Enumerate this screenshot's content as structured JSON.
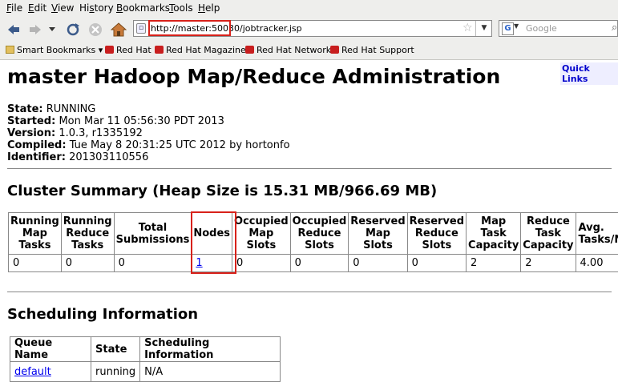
{
  "menubar": {
    "items": [
      {
        "pre": "",
        "u": "F",
        "post": "ile"
      },
      {
        "pre": "",
        "u": "E",
        "post": "dit"
      },
      {
        "pre": "",
        "u": "V",
        "post": "iew"
      },
      {
        "pre": "Hi",
        "u": "s",
        "post": "tory"
      },
      {
        "pre": "",
        "u": "B",
        "post": "ookmarks"
      },
      {
        "pre": "",
        "u": "T",
        "post": "ools"
      },
      {
        "pre": "",
        "u": "H",
        "post": "elp"
      }
    ]
  },
  "navbar": {
    "url": "http://master:50030/jobtracker.jsp",
    "search_placeholder": "Google"
  },
  "bookmarks": {
    "smart": "Smart Bookmarks",
    "items": [
      "Red Hat",
      "Red Hat Magazine",
      "Red Hat Network",
      "Red Hat Support"
    ]
  },
  "page": {
    "quick_links": "Quick Links",
    "title": "master Hadoop Map/Reduce Administration",
    "info": [
      {
        "label": "State:",
        "value": "RUNNING"
      },
      {
        "label": "Started:",
        "value": "Mon Mar 11 05:56:30 PDT 2013"
      },
      {
        "label": "Version:",
        "value": "1.0.3, r1335192"
      },
      {
        "label": "Compiled:",
        "value": "Tue May 8 20:31:25 UTC 2012 by hortonfo"
      },
      {
        "label": "Identifier:",
        "value": "201303110556"
      }
    ],
    "cluster_title": "Cluster Summary (Heap Size is 15.31 MB/966.69 MB)",
    "cluster_headers": [
      "Running Map Tasks",
      "Running Reduce Tasks",
      "Total Submissions",
      "Nodes",
      "Occupied Map Slots",
      "Occupied Reduce Slots",
      "Reserved Map Slots",
      "Reserved Reduce Slots",
      "Map Task Capacity",
      "Reduce Task Capacity",
      "Avg. Tasks/Node"
    ],
    "cluster_values": [
      "0",
      "0",
      "0",
      "1",
      "0",
      "0",
      "0",
      "0",
      "2",
      "2",
      "4.00"
    ],
    "sched_title": "Scheduling Information",
    "sched_headers": [
      "Queue Name",
      "State",
      "Scheduling Information"
    ],
    "sched_rows": [
      {
        "queue": "default",
        "state": "running",
        "info": "N/A"
      }
    ]
  }
}
